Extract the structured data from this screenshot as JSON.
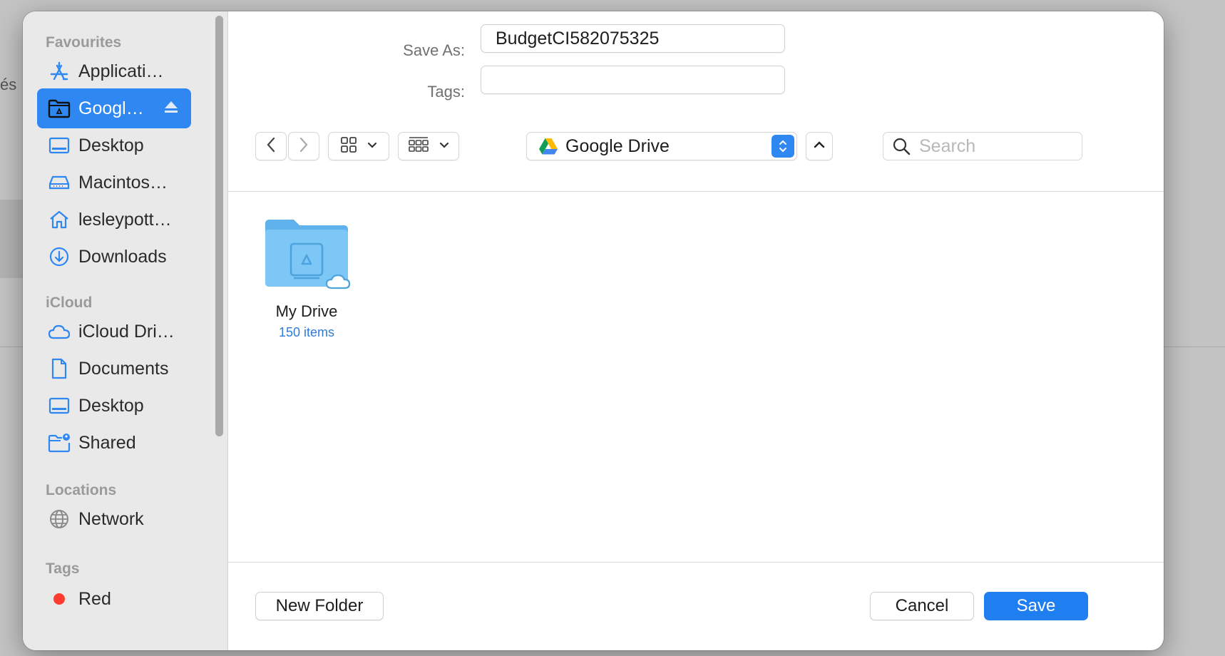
{
  "background": {
    "text": "és"
  },
  "sidebar": {
    "sections": {
      "favourites": "Favourites",
      "icloud": "iCloud",
      "locations": "Locations",
      "tags": "Tags"
    },
    "favourites": [
      {
        "label": "Applicati…",
        "icon": "applications-icon"
      },
      {
        "label": "Googl…",
        "icon": "google-drive-folder-icon",
        "selected": true
      },
      {
        "label": "Desktop",
        "icon": "desktop-icon"
      },
      {
        "label": "Macintos…",
        "icon": "disk-icon"
      },
      {
        "label": "lesleypott…",
        "icon": "home-icon"
      },
      {
        "label": "Downloads",
        "icon": "downloads-icon"
      }
    ],
    "icloud": [
      {
        "label": "iCloud Dri…",
        "icon": "cloud-icon"
      },
      {
        "label": "Documents",
        "icon": "document-icon"
      },
      {
        "label": "Desktop",
        "icon": "desktop-icon"
      },
      {
        "label": "Shared",
        "icon": "shared-folder-icon"
      }
    ],
    "locations": [
      {
        "label": "Network",
        "icon": "globe-icon"
      }
    ],
    "tags": [
      {
        "label": "Red",
        "color": "#ff3b30"
      }
    ]
  },
  "form": {
    "save_as_label": "Save As:",
    "save_as_value": "BudgetCI582075325",
    "tags_label": "Tags:",
    "tags_value": ""
  },
  "toolbar": {
    "location": "Google Drive",
    "search_placeholder": "Search"
  },
  "files": [
    {
      "name": "My Drive",
      "subtitle": "150 items"
    }
  ],
  "buttons": {
    "new_folder": "New Folder",
    "cancel": "Cancel",
    "save": "Save"
  },
  "colors": {
    "accent": "#2f87f1",
    "sidebar_bg": "#e9e9ea"
  }
}
